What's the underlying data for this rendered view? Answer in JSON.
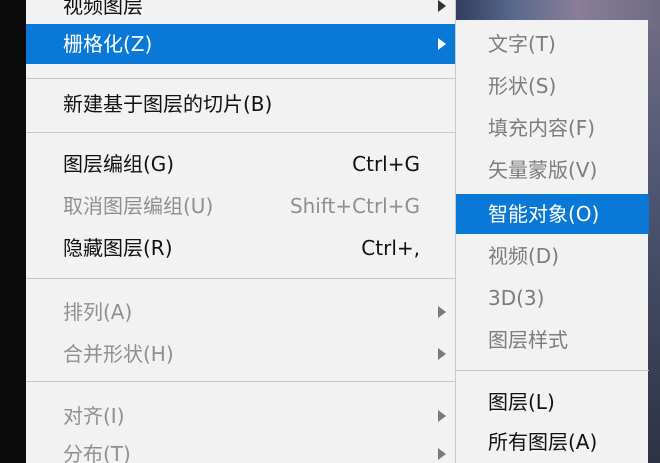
{
  "main_menu": {
    "items": [
      {
        "label": "视频图层",
        "shortcut": "",
        "submenu": true,
        "state": "normal"
      },
      {
        "label": "栅格化(Z)",
        "shortcut": "",
        "submenu": true,
        "state": "highlighted"
      },
      {
        "label": "新建基于图层的切片(B)",
        "shortcut": "",
        "submenu": false,
        "state": "normal"
      },
      {
        "label": "图层编组(G)",
        "shortcut": "Ctrl+G",
        "submenu": false,
        "state": "normal"
      },
      {
        "label": "取消图层编组(U)",
        "shortcut": "Shift+Ctrl+G",
        "submenu": false,
        "state": "disabled"
      },
      {
        "label": "隐藏图层(R)",
        "shortcut": "Ctrl+,",
        "submenu": false,
        "state": "normal"
      },
      {
        "label": "排列(A)",
        "shortcut": "",
        "submenu": true,
        "state": "disabled"
      },
      {
        "label": "合并形状(H)",
        "shortcut": "",
        "submenu": true,
        "state": "disabled"
      },
      {
        "label": "对齐(I)",
        "shortcut": "",
        "submenu": true,
        "state": "disabled"
      },
      {
        "label": "分布(T)",
        "shortcut": "",
        "submenu": true,
        "state": "disabled"
      }
    ]
  },
  "rasterize_submenu": {
    "items": [
      {
        "label": "文字(T)",
        "state": "disabled"
      },
      {
        "label": "形状(S)",
        "state": "disabled"
      },
      {
        "label": "填充内容(F)",
        "state": "disabled"
      },
      {
        "label": "矢量蒙版(V)",
        "state": "disabled"
      },
      {
        "label": "智能对象(O)",
        "state": "highlighted"
      },
      {
        "label": "视频(D)",
        "state": "disabled"
      },
      {
        "label": "3D(3)",
        "state": "disabled"
      },
      {
        "label": "图层样式",
        "state": "disabled"
      },
      {
        "label": "图层(L)",
        "state": "enabled"
      },
      {
        "label": "所有图层(A)",
        "state": "enabled"
      }
    ]
  },
  "colors": {
    "menu_background": "#f2f2f2",
    "highlight": "#0a78d7",
    "disabled_text": "#8f8f8f",
    "text": "#111111"
  }
}
